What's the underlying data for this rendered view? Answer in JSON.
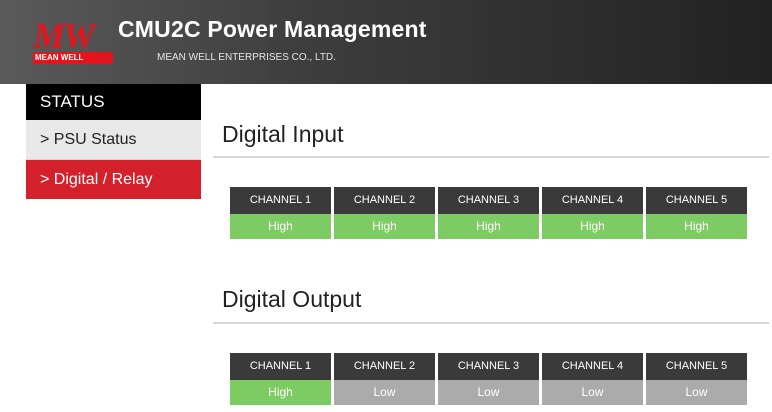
{
  "header": {
    "logo_text": "MW",
    "logo_band": "MEAN WELL",
    "title": "CMU2C Power Management",
    "subtitle": "MEAN WELL ENTERPRISES CO., LTD."
  },
  "sidebar": {
    "heading": "STATUS",
    "items": [
      {
        "label": "> PSU Status",
        "active": false
      },
      {
        "label": "> Digital / Relay",
        "active": true
      }
    ]
  },
  "digital_input": {
    "title": "Digital Input",
    "channels": [
      {
        "label": "CHANNEL 1",
        "value": "High"
      },
      {
        "label": "CHANNEL 2",
        "value": "High"
      },
      {
        "label": "CHANNEL 3",
        "value": "High"
      },
      {
        "label": "CHANNEL 4",
        "value": "High"
      },
      {
        "label": "CHANNEL 5",
        "value": "High"
      }
    ]
  },
  "digital_output": {
    "title": "Digital Output",
    "channels": [
      {
        "label": "CHANNEL 1",
        "value": "High"
      },
      {
        "label": "CHANNEL 2",
        "value": "Low"
      },
      {
        "label": "CHANNEL 3",
        "value": "Low"
      },
      {
        "label": "CHANNEL 4",
        "value": "Low"
      },
      {
        "label": "CHANNEL 5",
        "value": "Low"
      }
    ]
  },
  "colors": {
    "brand_red": "#e2141d",
    "active_red": "#d3202a",
    "high_green": "#7ccc63",
    "low_gray": "#ababab",
    "label_dark": "#3a3a3a"
  }
}
